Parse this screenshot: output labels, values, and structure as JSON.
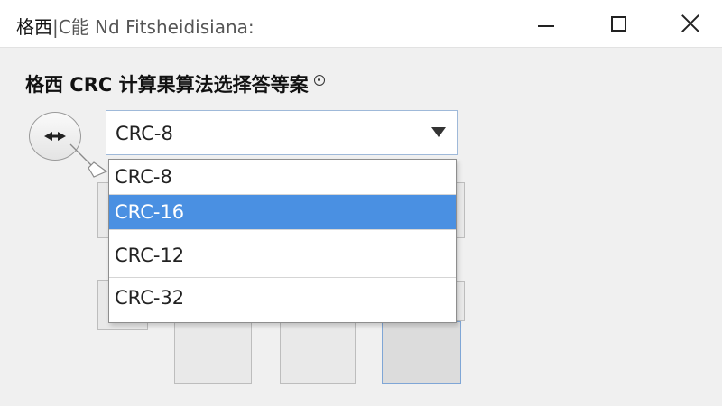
{
  "window": {
    "title_primary": "格西",
    "title_secondary": "|C能  Nd Fitsheidisiana:",
    "minimize_icon": "minimize-icon",
    "maximize_icon": "maximize-icon",
    "close_icon": "close-icon"
  },
  "page": {
    "title": "格西  CRC 计算果算法选择答等案",
    "title_icon": "info-icon"
  },
  "combo": {
    "selected": "CRC-8",
    "options": [
      "CRC-8",
      "CRC-16",
      "CRC-12",
      "CRC-32"
    ],
    "highlighted": "CRC-16"
  },
  "colors": {
    "highlight": "#4a90e2",
    "combo_border": "#9fb9d9"
  }
}
